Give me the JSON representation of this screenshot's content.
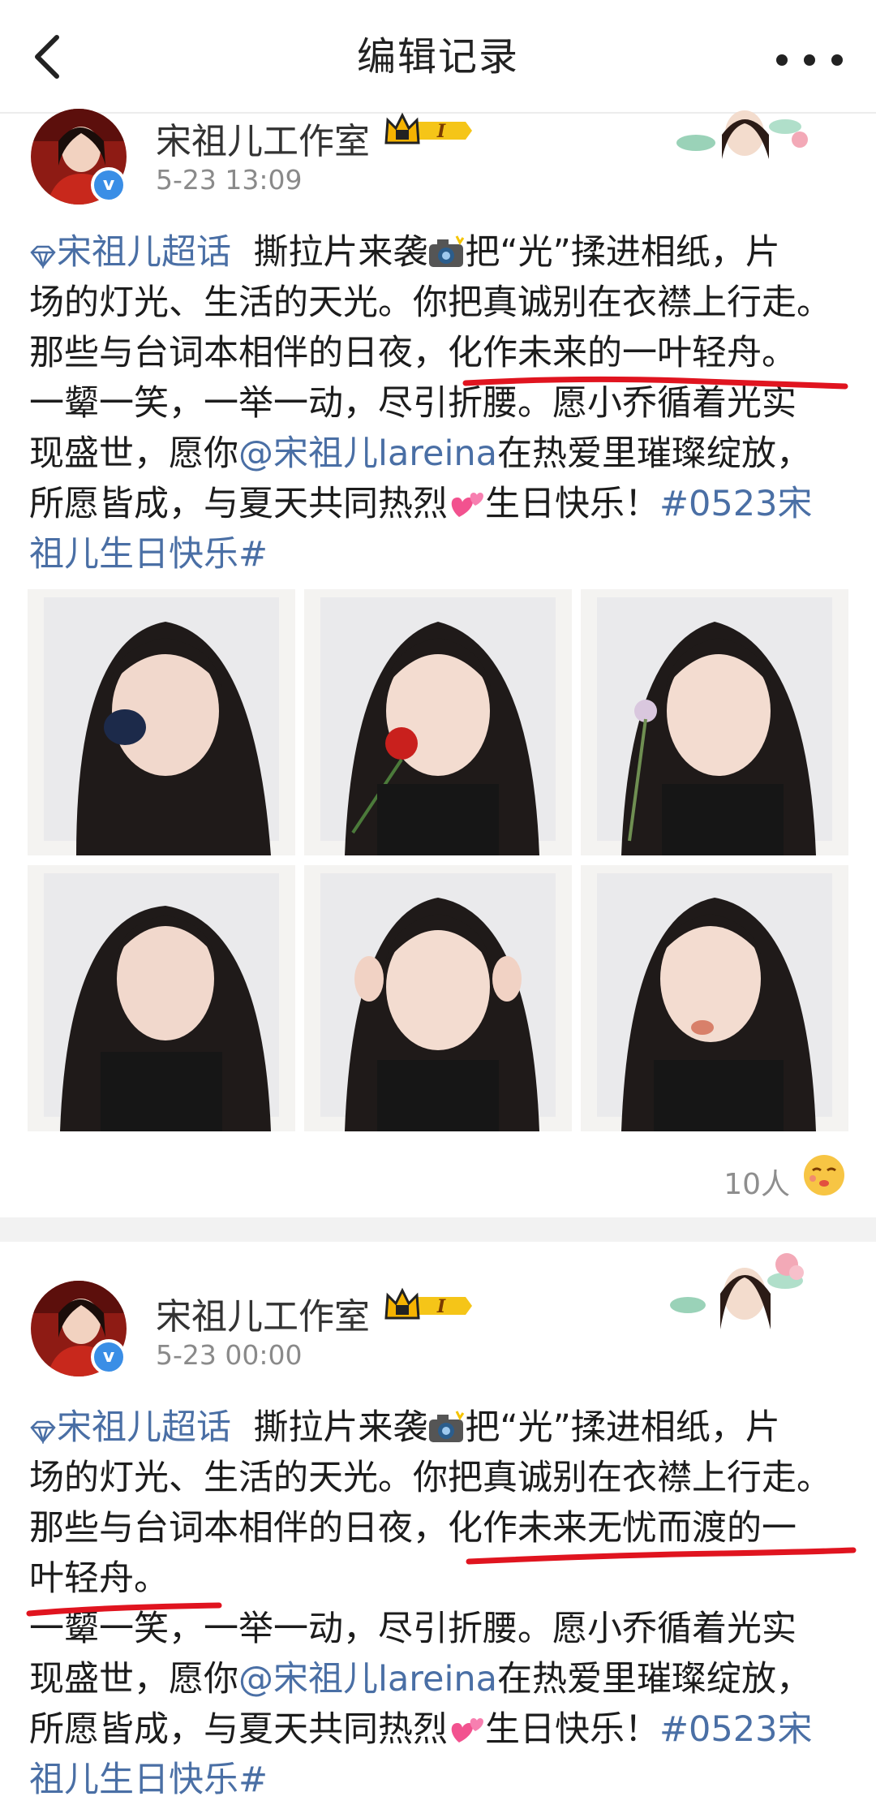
{
  "header": {
    "title": "编辑记录"
  },
  "icons": {
    "back": "chevron-left-icon",
    "more": "more-dots-icon",
    "verified": "verified-icon",
    "vip": "crown-vip-icon",
    "super_topic": "diamond-icon",
    "camera": "camera-flash-icon",
    "hearts": "two-hearts-icon",
    "reaction": "kiss-face-icon"
  },
  "colors": {
    "link": "#4a6fa5",
    "underline": "#e0141f",
    "verified": "#3a8ee6",
    "vip_gold": "#f5b301"
  },
  "posts": [
    {
      "author": "宋祖儿工作室",
      "vip_level": "I",
      "verified_mark": "v",
      "time": "5-23 13:09",
      "text": {
        "super_topic": "宋祖儿超话",
        "l1_a": "撕拉片来袭",
        "l1_b": "把“光”揉进相纸，片",
        "l2": "场的灯光、生活的天光。你把真诚别在衣襟上行走。",
        "l3": "那些与台词本相伴的日夜，化作未来的一叶轻舟。",
        "l4": "一颦一笑，一举一动，尽引折腰。愿小乔循着光实",
        "l5_a": "现盛世，愿你",
        "mention": "@宋祖儿lareina",
        "l5_b": "在热爱里璀璨绽放，",
        "l6_a": "所愿皆成，与夏天共同热烈",
        "l6_b": "生日快乐！",
        "hashtag_a": "#0523宋",
        "hashtag_b": "祖儿生日快乐#"
      },
      "photo_count": 6,
      "likes": "10人"
    },
    {
      "author": "宋祖儿工作室",
      "vip_level": "I",
      "verified_mark": "v",
      "time": "5-23 00:00",
      "text": {
        "super_topic": "宋祖儿超话",
        "l1_a": "撕拉片来袭",
        "l1_b": "把“光”揉进相纸，片",
        "l2": "场的灯光、生活的天光。你把真诚别在衣襟上行走。",
        "l3": "那些与台词本相伴的日夜，化作未来无忧而渡的一",
        "l4": "叶轻舟。",
        "l5": "一颦一笑，一举一动，尽引折腰。愿小乔循着光实",
        "l6_a": "现盛世，愿你",
        "mention": "@宋祖儿lareina",
        "l6_b": "在热爱里璀璨绽放，",
        "l7_a": "所愿皆成，与夏天共同热烈",
        "l7_b": "生日快乐！",
        "hashtag_a": "#0523宋",
        "hashtag_b": "祖儿生日快乐#"
      }
    }
  ]
}
